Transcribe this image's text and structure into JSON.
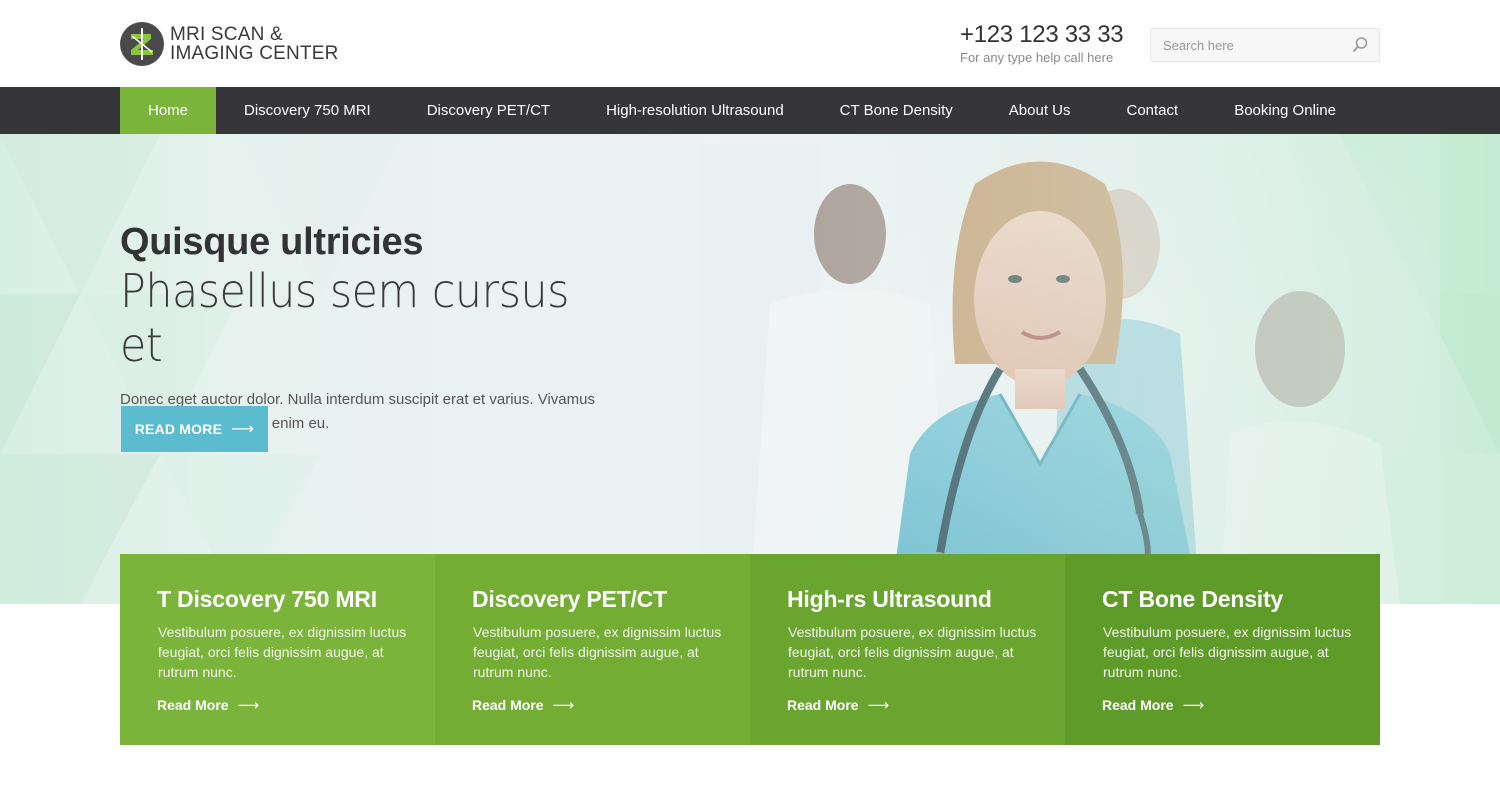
{
  "header": {
    "logo_line1": "MRI SCAN &",
    "logo_line2": "IMAGING CENTER",
    "phone": "+123 123 33 33",
    "phone_caption": "For any type help call here",
    "search_placeholder": "Search here",
    "search_icon": "search-icon"
  },
  "nav": {
    "items": [
      {
        "label": "Home",
        "active": true
      },
      {
        "label": "Discovery 750 MRI",
        "active": false
      },
      {
        "label": "Discovery PET/CT",
        "active": false
      },
      {
        "label": "High-resolution Ultrasound",
        "active": false
      },
      {
        "label": "CT Bone Density",
        "active": false
      },
      {
        "label": "About Us",
        "active": false
      },
      {
        "label": "Contact",
        "active": false
      },
      {
        "label": "Booking Online",
        "active": false
      }
    ]
  },
  "hero": {
    "title_bold": "Quisque ultricies",
    "title_light": "Phasellus sem cursus et",
    "description": "Donec eget auctor dolor. Nulla interdum suscipit erat et varius. Vivamus leo leo, bibendum non enim eu.",
    "button_label": "READ MORE",
    "button_arrow": "⟶",
    "image_alt": "Smiling nurse with stethoscope and medical staff"
  },
  "cards": [
    {
      "title": "T Discovery 750 MRI",
      "text": "Vestibulum posuere, ex dignissim luctus feugiat, orci felis dignissim augue, at rutrum nunc.",
      "link": "Read More",
      "arrow": "⟶"
    },
    {
      "title": "Discovery PET/CT",
      "text": "Vestibulum posuere, ex dignissim luctus feugiat, orci felis dignissim augue, at rutrum nunc.",
      "link": "Read More",
      "arrow": "⟶"
    },
    {
      "title": "High-rs Ultrasound",
      "text": "Vestibulum posuere, ex dignissim luctus feugiat, orci felis dignissim augue, at rutrum nunc.",
      "link": "Read More",
      "arrow": "⟶"
    },
    {
      "title": "CT Bone Density",
      "text": "Vestibulum posuere, ex dignissim luctus feugiat, orci felis dignissim augue, at rutrum nunc.",
      "link": "Read More",
      "arrow": "⟶"
    }
  ],
  "colors": {
    "accent_green": "#7bb43a",
    "nav_dark": "#363638",
    "button_blue": "#5bbccf"
  }
}
